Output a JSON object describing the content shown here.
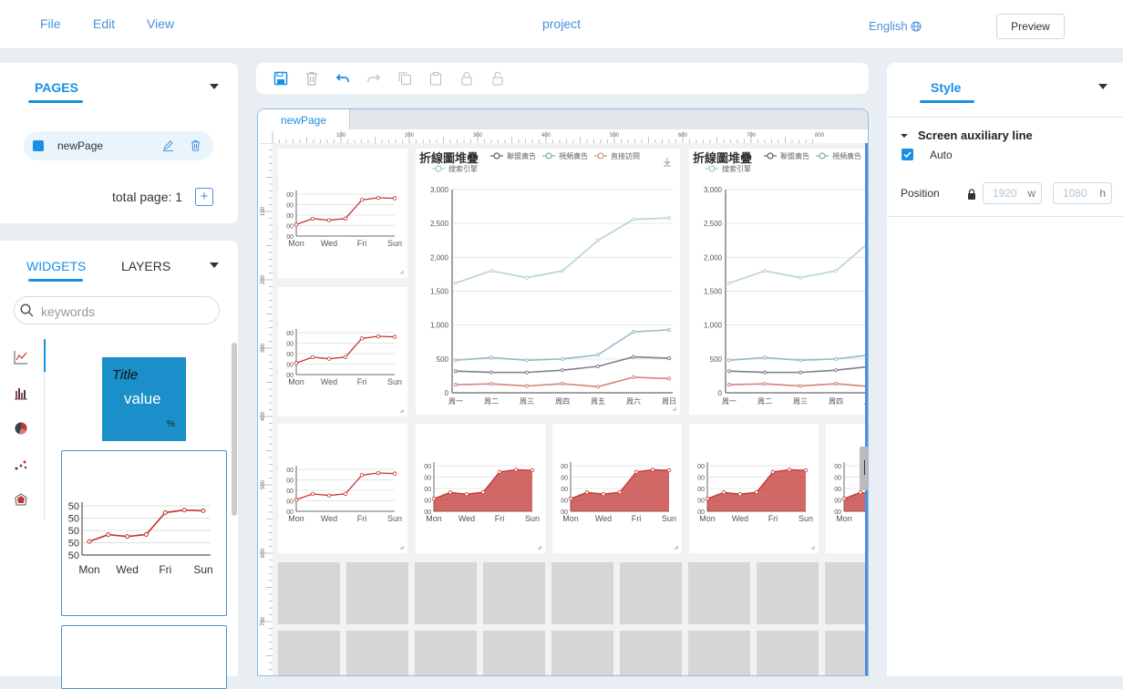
{
  "menu": {
    "file": "File",
    "edit": "Edit",
    "view": "View"
  },
  "project": "project",
  "language": "English",
  "preview": "Preview",
  "pages": {
    "title": "PAGES",
    "item": "newPage",
    "total": "total page: 1"
  },
  "widgets": {
    "tab_widgets": "WIDGETS",
    "tab_layers": "LAYERS",
    "search_placeholder": "keywords",
    "card_title": "Title",
    "card_value": "value",
    "card_unit": "%"
  },
  "canvas": {
    "page_tab": "newPage",
    "ruler_top": [
      "100",
      "200",
      "300",
      "400",
      "500",
      "600",
      "700",
      "800"
    ],
    "ruler_left": [
      "100",
      "200",
      "300",
      "400",
      "500",
      "600",
      "700"
    ]
  },
  "small_chart": {
    "x": [
      "Mon",
      "Wed",
      "Fri",
      "Sun"
    ],
    "values": [
      820,
      932,
      901,
      934,
      1290,
      1330,
      1320
    ]
  },
  "big_chart": {
    "title": "折線圖堆疊",
    "legend": [
      "聯盟廣告",
      "視頻廣告",
      "直接訪問",
      "搜索引擎"
    ],
    "x": [
      "周一",
      "周二",
      "周三",
      "周四",
      "周五",
      "周六",
      "周日"
    ],
    "y": [
      "0",
      "500",
      "1,000",
      "1,500",
      "2,000",
      "2,500",
      "3,000"
    ]
  },
  "style_panel": {
    "tab": "Style",
    "aux_line": "Screen auxiliary line",
    "auto": "Auto",
    "position": "Position",
    "width": "1920",
    "w": "w",
    "height": "1080",
    "h": "h"
  },
  "chart_data": {
    "type": "line",
    "categories": [
      "周一",
      "周二",
      "周三",
      "周四",
      "周五",
      "周六",
      "周日"
    ],
    "series": [
      {
        "name": "聯盟廣告",
        "values": [
          320,
          302,
          301,
          334,
          390,
          530,
          510
        ]
      },
      {
        "name": "視頻廣告",
        "values": [
          480,
          520,
          480,
          500,
          560,
          900,
          930
        ]
      },
      {
        "name": "直接訪問",
        "values": [
          120,
          132,
          101,
          134,
          90,
          230,
          210
        ]
      },
      {
        "name": "搜索引擎",
        "values": [
          1620,
          1800,
          1700,
          1800,
          2250,
          2560,
          2580
        ]
      }
    ],
    "ylim": [
      0,
      3000
    ]
  },
  "colors": {
    "accent": "#1a8fe6",
    "chart_red": "#c23531",
    "widget_card": "#1a8fc9"
  }
}
